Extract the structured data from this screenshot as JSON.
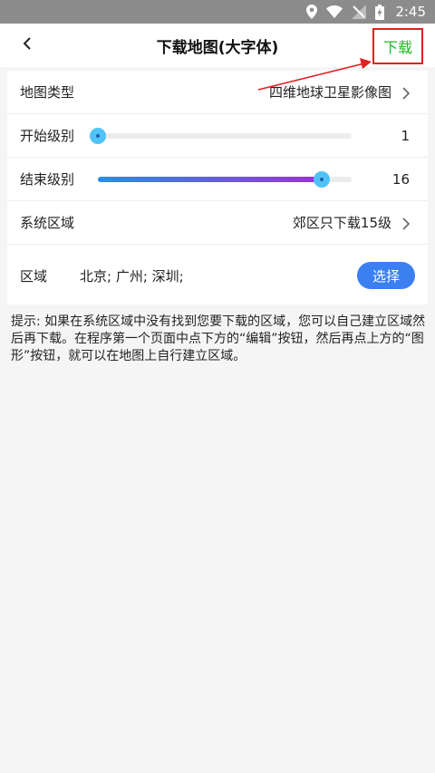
{
  "status_bar": {
    "time": "2:45",
    "icons": [
      "location-icon",
      "wifi-icon",
      "no-signal-icon",
      "battery-charging-icon"
    ]
  },
  "app_bar": {
    "title": "下载地图(大字体)",
    "back_icon": "chevron-left-icon",
    "download_label": "下载"
  },
  "settings": {
    "map_type": {
      "label": "地图类型",
      "value": "四维地球卫星影像图"
    },
    "start_level": {
      "label": "开始级别",
      "value": "1",
      "level": 1,
      "min": 1,
      "max": 18
    },
    "end_level": {
      "label": "结束级别",
      "value": "16",
      "level": 16,
      "min": 1,
      "max": 18
    },
    "system_region": {
      "label": "系统区域",
      "value": "郊区只下载15级"
    },
    "region": {
      "label": "区域",
      "value": "北京; 广州; 深圳;",
      "select_label": "选择"
    }
  },
  "tip": "提示: 如果在系统区域中没有找到您要下载的区域，您可以自己建立区域然后再下载。在程序第一个页面中点下方的“编辑”按钮，然后再点上方的“图形”按钮，就可以在地图上自行建立区域。",
  "colors": {
    "accent": "#3b7ff0",
    "download_text": "#22bb22",
    "annotation": "#e02020"
  }
}
